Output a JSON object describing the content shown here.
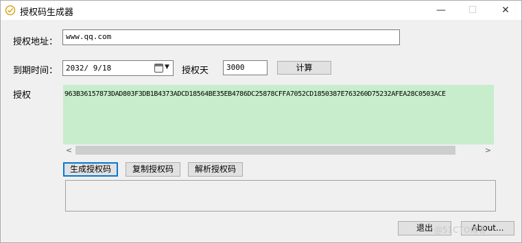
{
  "window": {
    "title": "授权码生成器",
    "buttons": {
      "minimize": "—",
      "maximize": "☐",
      "close": "✕"
    }
  },
  "form": {
    "address_label": "授权地址：",
    "address_value": "www.qq.com",
    "expire_label": "到期时间：",
    "expire_value": "2032/ 9/18",
    "days_label": "授权天",
    "days_value": "3000",
    "calc_button": "计算",
    "code_label": "授权",
    "code_value": "963B36157873DAD803F3DB1B4373ADCD18564BE35EB4786DC25878CFFA7052CD1850387E763260D75232AFEA28C0503ACE"
  },
  "actions": {
    "generate": "生成授权码",
    "copy": "复制授权码",
    "parse": "解析授权码"
  },
  "footer": {
    "exit": "退出",
    "about": "About...",
    "watermark": "@51CTO博客"
  },
  "icons": {
    "app": "check-circle-icon",
    "calendar": "calendar-icon",
    "dropdown": "chevron-down-icon",
    "scroll_left": "chevron-left-icon",
    "scroll_right": "chevron-right-icon"
  },
  "colors": {
    "code_background": "#c7edcc",
    "window_background": "#f0f0f0",
    "focus_border": "#0078d7",
    "app_icon": "#d8a21e"
  }
}
